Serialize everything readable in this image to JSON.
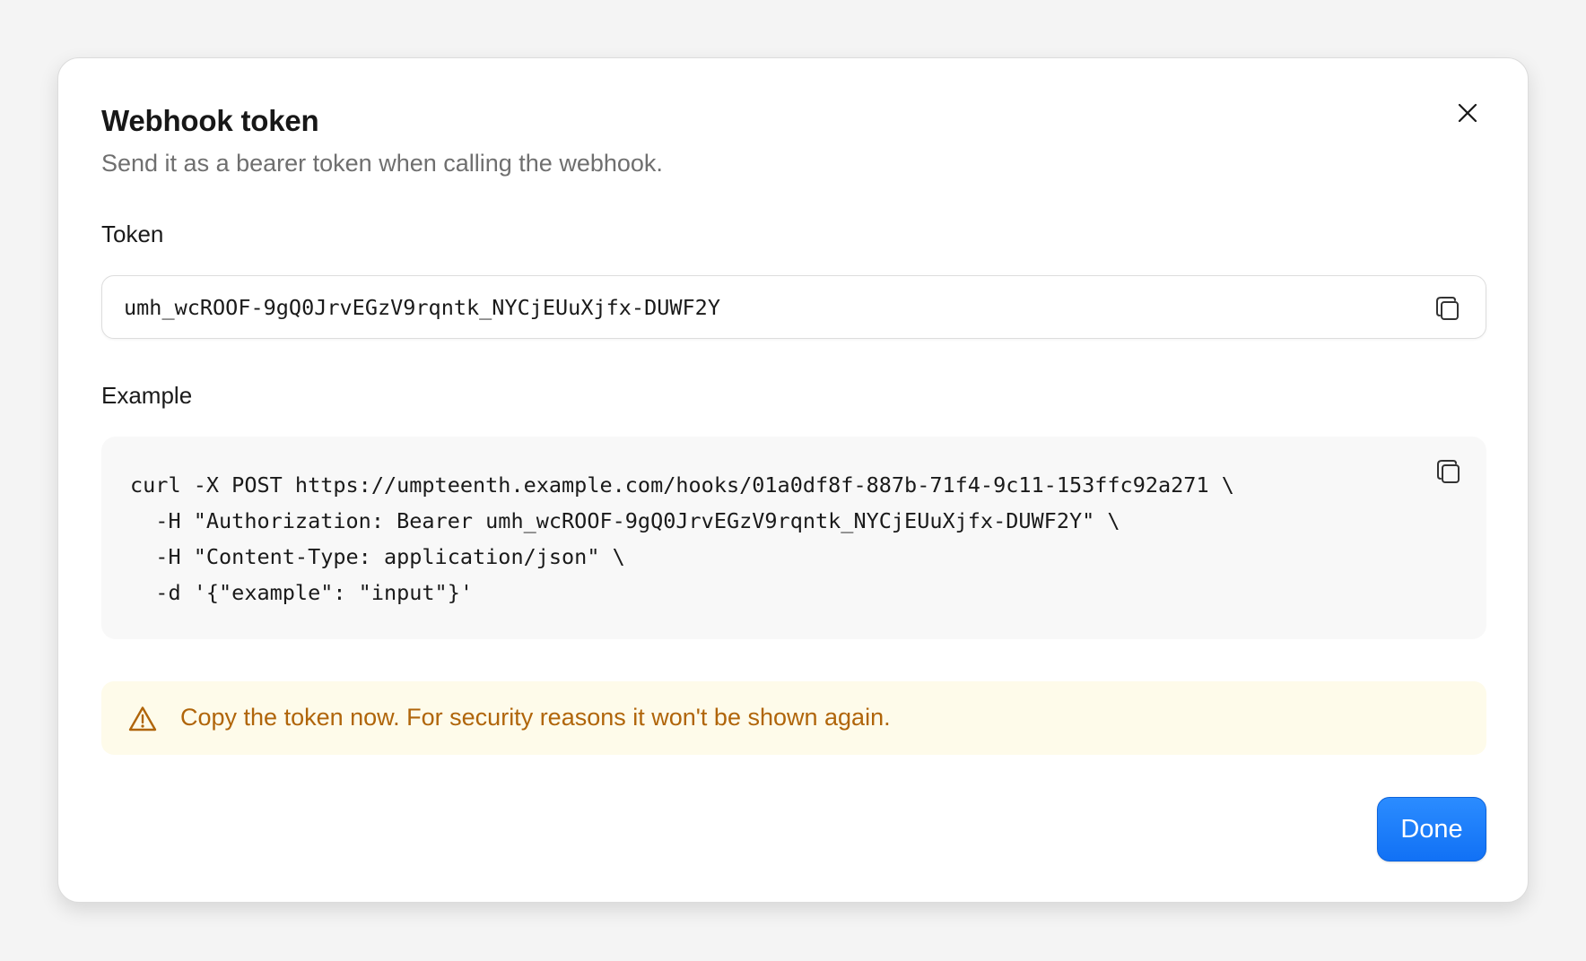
{
  "dialog": {
    "title": "Webhook token",
    "subtitle": "Send it as a bearer token when calling the webhook.",
    "close_icon": "close-icon"
  },
  "token": {
    "label": "Token",
    "value": "umh_wcROOF-9gQ0JrvEGzV9rqntk_NYCjEUuXjfx-DUWF2Y",
    "copy_icon": "copy-icon"
  },
  "example": {
    "label": "Example",
    "lines": [
      "curl -X POST https://umpteenth.example.com/hooks/01a0df8f-887b-71f4-9c11-153ffc92a271 \\",
      "  -H \"Authorization: Bearer umh_wcROOF-9gQ0JrvEGzV9rqntk_NYCjEUuXjfx-DUWF2Y\" \\",
      "  -H \"Content-Type: application/json\" \\",
      "  -d '{\"example\": \"input\"}'"
    ],
    "copy_icon": "copy-icon"
  },
  "warning": {
    "text": "Copy the token now. For security reasons it won't be shown again.",
    "icon": "warning-triangle-icon",
    "color": "#b0650a",
    "background": "#fefbea"
  },
  "actions": {
    "done_label": "Done",
    "accent": "#1171f5"
  }
}
